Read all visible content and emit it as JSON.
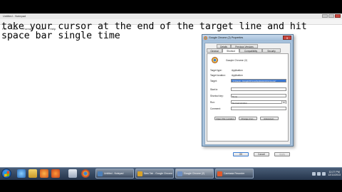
{
  "notepad": {
    "title": "Untitled - Notepad",
    "menu": [
      "File",
      "Edit",
      "Format",
      "View",
      "Help"
    ],
    "text": "take your cursor at the end of the target line and hit space bar single time"
  },
  "dialog": {
    "title": "Google Chrome (2) Properties",
    "close": "x",
    "tabs_row1": [
      "Details",
      "Previous Versions"
    ],
    "tabs_row2": [
      "General",
      "Shortcut",
      "Compatibility",
      "Security"
    ],
    "active_tab": "Shortcut",
    "app_name": "Google Chrome (2)",
    "fields": {
      "target_type_label": "Target type:",
      "target_type_value": "Application",
      "target_location_label": "Target location:",
      "target_location_value": "Application",
      "target_label": "Target:",
      "target_value": "\"C:\\Users\\...\\Google\\Chrome\\Application\\chrome.exe\"",
      "start_in_label": "Start in:",
      "start_in_value": "",
      "shortcut_key_label": "Shortcut key:",
      "shortcut_key_value": "None",
      "run_label": "Run:",
      "run_value": "Normal window",
      "comment_label": "Comment:",
      "comment_value": ""
    },
    "buttons": {
      "open_location": "Open File Location",
      "change_icon": "Change Icon...",
      "advanced": "Advanced...",
      "ok": "OK",
      "cancel": "Cancel",
      "apply": "Apply"
    }
  },
  "taskbar": {
    "items": [
      {
        "label": "Untitled - Notepad",
        "color": "#4d7fb8"
      },
      {
        "label": "New Tab - Google Chrome",
        "color": "#d8a22a"
      },
      {
        "label": "Google Chrome (2)",
        "color": "#6d8fc2"
      },
      {
        "label": "Camtasia Recorder",
        "color": "#e05a2b"
      }
    ],
    "clock_time": "12:27 PM",
    "clock_date": "12/11/2013"
  }
}
